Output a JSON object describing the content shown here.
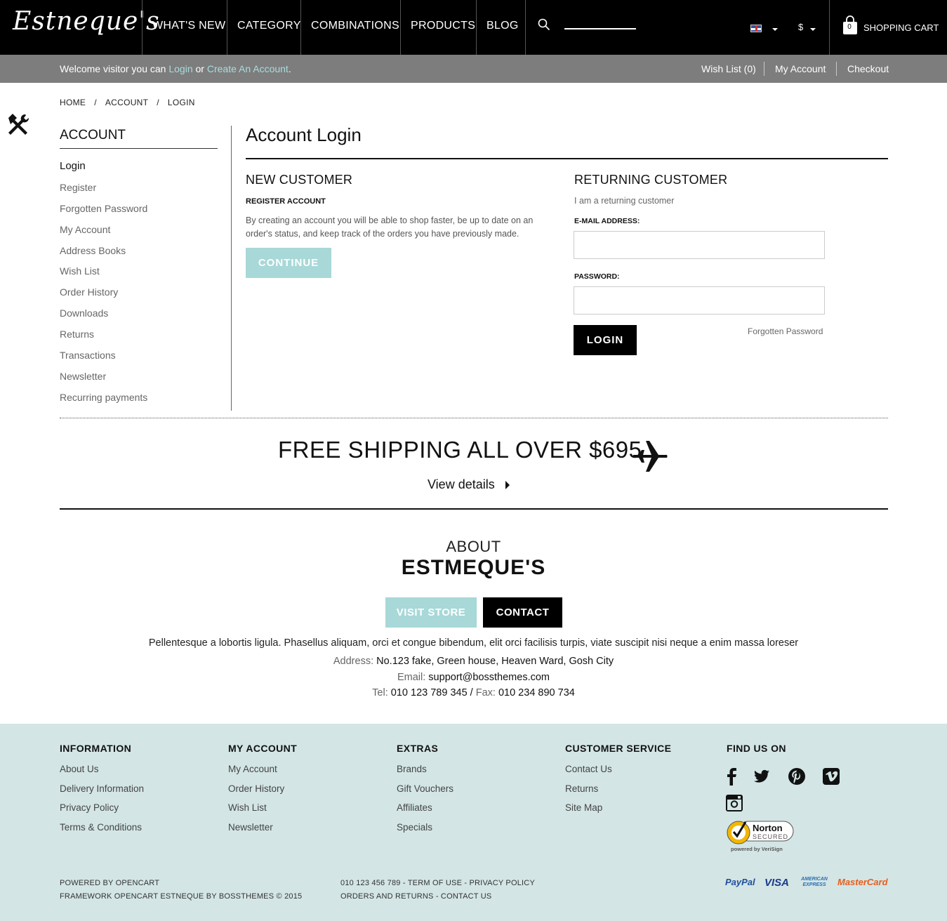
{
  "header": {
    "logo": "Estneque's",
    "nav": [
      "WHAT'S NEW",
      "CATEGORY",
      "COMBINATIONS",
      "PRODUCTS",
      "BLOG"
    ],
    "currency": "$",
    "cart_count": "0",
    "cart_label": "SHOPPING CART"
  },
  "welcome_bar": {
    "prefix": "Welcome visitor you can ",
    "login": "Login",
    "or": " or ",
    "create": "Create An Account",
    "suffix": ".",
    "wishlist": "Wish List (0)",
    "my_account": "My Account",
    "checkout": "Checkout"
  },
  "breadcrumb": [
    "HOME",
    "ACCOUNT",
    "LOGIN"
  ],
  "breadcrumb_sep": "/",
  "sidebar": {
    "title": "ACCOUNT",
    "items": [
      "Login",
      "Register",
      "Forgotten Password",
      "My Account",
      "Address Books",
      "Wish List",
      "Order History",
      "Downloads",
      "Returns",
      "Transactions",
      "Newsletter",
      "Recurring payments"
    ]
  },
  "main": {
    "title": "Account Login",
    "new_customer": {
      "heading": "NEW CUSTOMER",
      "subheading": "REGISTER ACCOUNT",
      "text": "By creating an account you will be able to shop faster, be up to date on an order's status, and keep track of the orders you have previously made.",
      "button": "CONTINUE"
    },
    "returning": {
      "heading": "RETURNING CUSTOMER",
      "subheading": "I am a returning customer",
      "email_label": "E-MAIL ADDRESS:",
      "email_value": "",
      "password_label": "PASSWORD:",
      "password_value": "",
      "login_button": "LOGIN",
      "forgot": "Forgotten Password"
    }
  },
  "shipping": {
    "title": "FREE SHIPPING ALL OVER $695",
    "link": "View details"
  },
  "about": {
    "small": "ABOUT",
    "big": "ESTMEQUE'S",
    "visit": "VISIT STORE",
    "contact": "CONTACT",
    "text": "Pellentesque a lobortis ligula. Phasellus aliquam, orci et congue bibendum, elit orci facilisis turpis, viate suscipit nisi neque a enim massa loreser",
    "address_label": "Address:",
    "address": " No.123 fake, Green house, Heaven Ward, Gosh City",
    "email_label": "Email:",
    "email": " support@bossthemes.com",
    "tel_label": "Tel:",
    "tel": " 010 123 789 345 / ",
    "fax_label": "Fax:",
    "fax": " 010 234 890 734"
  },
  "footer": {
    "information": {
      "title": "INFORMATION",
      "items": [
        "About Us",
        "Delivery Information",
        "Privacy Policy",
        "Terms & Conditions"
      ]
    },
    "my_account": {
      "title": "MY ACCOUNT",
      "items": [
        "My Account",
        "Order History",
        "Wish List",
        "Newsletter"
      ]
    },
    "extras": {
      "title": "EXTRAS",
      "items": [
        "Brands",
        "Gift Vouchers",
        "Affiliates",
        "Specials"
      ]
    },
    "customer_service": {
      "title": "CUSTOMER SERVICE",
      "items": [
        "Contact Us",
        "Returns",
        "Site Map"
      ]
    },
    "find_us": "FIND US ON",
    "social_icons": [
      "facebook-icon",
      "twitter-icon",
      "pinterest-icon",
      "vimeo-icon",
      "instagram-icon"
    ],
    "norton": {
      "line1": "Norton",
      "line2": "SECURED",
      "line3": "powered by VeriSign"
    },
    "bottom_left": [
      "POWERED BY OPENCART",
      "FRAMEWORK OPENCART ESTNEQUE BY BOSSTHEMES © 2015"
    ],
    "bottom_mid": [
      "010 123 456 789 - TERM OF USE - PRIVACY POLICY",
      "ORDERS AND RETURNS - CONTACT US"
    ],
    "payments": [
      "PayPal",
      "VISA",
      "AMERICAN EXPRESS",
      "MasterCard"
    ]
  },
  "colors": {
    "accent": "#a8d8d8",
    "footer_bg": "#d3e5e5",
    "topbar": "#000000",
    "welcome_bar": "#7d7d7d"
  }
}
